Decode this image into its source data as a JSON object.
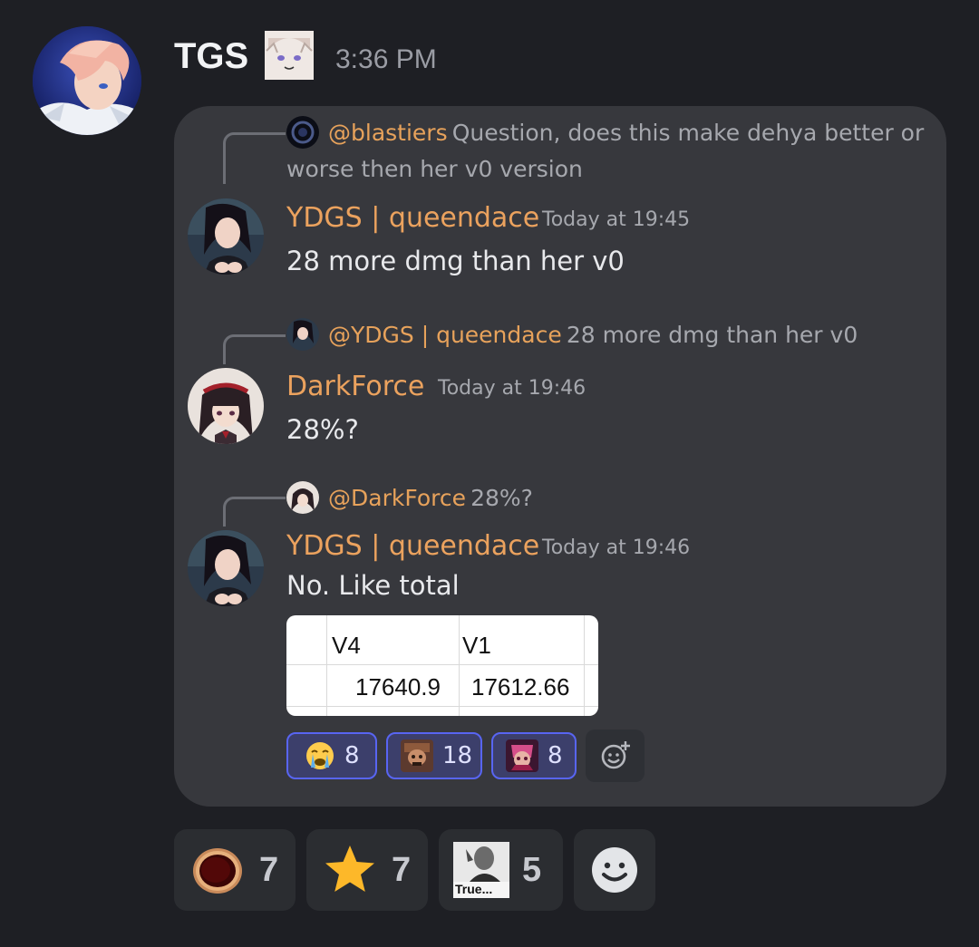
{
  "message": {
    "author": "TGS",
    "timestamp": "3:36 PM",
    "author_sticker_icon": "anime-face-sticker"
  },
  "screenshot": {
    "messages": [
      {
        "reply_to": {
          "mention": "@blastiers",
          "text": "Question, does this make dehya better or worse then her v0 version"
        },
        "author": "YDGS | queendace",
        "time": "Today at 19:45",
        "text": "28 more dmg than her v0"
      },
      {
        "reply_to": {
          "mention": "@YDGS | queendace",
          "text": "28 more dmg than her v0"
        },
        "author": "DarkForce",
        "time": "Today at 19:46",
        "text": "28%?"
      },
      {
        "reply_to": {
          "mention": "@DarkForce",
          "text": "28%?"
        },
        "author": "YDGS | queendace",
        "time": "Today at 19:46",
        "text": "No. Like total"
      }
    ],
    "table": {
      "headers": [
        "V4",
        "V1"
      ],
      "values": [
        "17640.9",
        "17612.66"
      ]
    },
    "reactions": [
      {
        "icon": "crying-face-icon",
        "count": "8"
      },
      {
        "icon": "character-emote-icon",
        "count": "18"
      },
      {
        "icon": "character-emote-pink-icon",
        "count": "8"
      }
    ]
  },
  "reactions": [
    {
      "icon": "ring-icon",
      "count": "7"
    },
    {
      "icon": "star-icon",
      "count": "7"
    },
    {
      "icon": "true-meme-icon",
      "label": "True...",
      "count": "5"
    }
  ],
  "colors": {
    "background": "#1e1f24",
    "card": "#37383d",
    "username": "#eba25e",
    "reaction_active": "#5865f2"
  }
}
